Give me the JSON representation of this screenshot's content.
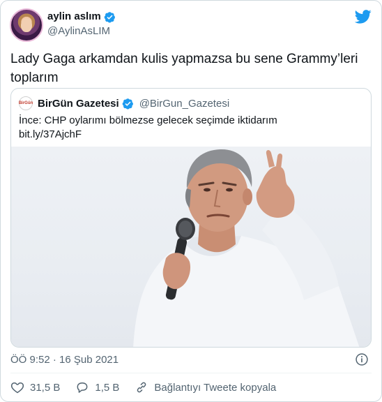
{
  "author": {
    "display_name": "aylin aslım",
    "handle": "@AylinAsLIM"
  },
  "tweet": {
    "text": "Lady Gaga arkamdan kulis yapmazsa bu sene Grammy’leri toplarım",
    "timestamp": "ÖÖ 9:52 · 16 Şub 2021"
  },
  "quoted": {
    "avatar_text": "BirGün",
    "display_name": "BirGün Gazetesi",
    "handle": "@BirGun_Gazetesi",
    "text_line1": "İnce: CHP oylarımı bölmezse gelecek seçimde iktidarım",
    "text_line2": "bit.ly/37AjchF"
  },
  "actions": {
    "likes": "31,5 B",
    "replies": "1,5 B",
    "copy_link": "Bağlantıyı Tweete kopyala"
  },
  "colors": {
    "text": "#0f1419",
    "secondary": "#536471",
    "twitter_blue": "#1d9bf0",
    "border": "#cfd9de"
  },
  "icons": [
    "verified-badge-icon",
    "twitter-bird-icon",
    "info-icon",
    "heart-icon",
    "reply-icon",
    "link-icon"
  ]
}
